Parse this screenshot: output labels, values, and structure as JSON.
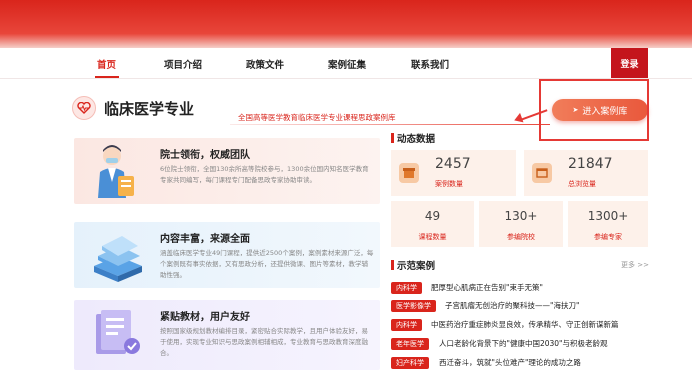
{
  "nav": {
    "items": [
      "首页",
      "项目介绍",
      "政策文件",
      "案例征集",
      "联系我们"
    ],
    "login": "登录"
  },
  "brand": {
    "title": "临床医学专业",
    "subtitle": "全国高等医学教育临床医学专业课程思政案例库",
    "case_button": "进入案例库",
    "icon": "heart-icon"
  },
  "features": [
    {
      "title": "院士领衔，权威团队",
      "desc": "6位院士领衔，全国130余所高等院校参与，1300余位国内知名医学教育专家共同编写，每门课程专门配备思政专家协助审读。"
    },
    {
      "title": "内容丰富，来源全面",
      "desc": "涵盖临床医学专业49门课程，提供近2500个案例，案例素材来源广泛，每个案例既有事实依据，又有思政分析，还提供微课、图片等素材，教学辅助性强。"
    },
    {
      "title": "紧贴教材，用户友好",
      "desc": "按照国家级规划教材编排目录，紧密贴合实际教学，且用户体验友好，易于使用，实现专业知识与思政案例相辅相成，专业教育与思政教育深度融合。"
    }
  ],
  "dynamic": {
    "heading": "动态数据",
    "cards": [
      {
        "value": "2457",
        "label": "案例数量",
        "icon": "box-icon"
      },
      {
        "value": "21847",
        "label": "总浏览量",
        "icon": "browser-icon"
      }
    ],
    "stats": [
      {
        "value": "49",
        "label": "课程数量"
      },
      {
        "value": "130+",
        "label": "参编院校"
      },
      {
        "value": "1300+",
        "label": "参编专家"
      }
    ]
  },
  "cases": {
    "heading": "示范案例",
    "more": "更多 >>",
    "items": [
      {
        "tag": "内科学",
        "text": "肥厚型心肌病正在告别\"束手无策\""
      },
      {
        "tag": "医学影像学",
        "text": "子宫肌瘤无创治疗的聚科技——\"海扶刀\""
      },
      {
        "tag": "内科学",
        "text": "中医药治疗重症肺炎显良效，传承精华、守正创新谋新篇"
      },
      {
        "tag": "老年医学",
        "text": "人口老龄化背景下的\"健康中国2030\"与积极老龄观"
      },
      {
        "tag": "妇产科学",
        "text": "西迁奋斗，筑就\"头位难产\"理论的成功之路"
      }
    ]
  },
  "colors": {
    "brand_red": "#d9251c",
    "accent_orange": "#e9583c"
  }
}
